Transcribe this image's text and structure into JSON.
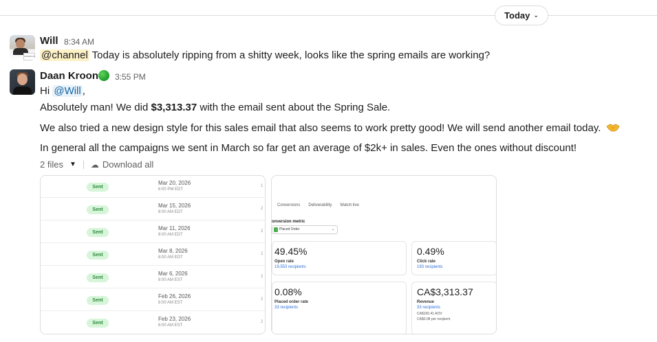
{
  "divider": {
    "label": "Today"
  },
  "messages": [
    {
      "author": "Will",
      "time": "8:34 AM",
      "mention": "@channel",
      "text": " Today is absolutely ripping from a shitty week, looks like the spring emails are working?"
    },
    {
      "author": "Daan Kroon",
      "time": "3:55 PM",
      "greeting": "Hi ",
      "mention": "@Will",
      "greeting_end": ",",
      "line2_pre": "Absolutely man! We did ",
      "line2_bold": "$3,313.37",
      "line2_post": " with the email sent about the Spring Sale.",
      "line3": "We also tried a new design style for this sales email that also seems to work pretty good! We will send another email today.",
      "line4": "In general all the campaigns we sent in March so far get an average of $2k+ in sales. Even the ones without discount!"
    }
  ],
  "attachments": {
    "count_label": "2 files",
    "download_label": "Download all"
  },
  "email_list": {
    "rows": [
      {
        "status": "Sent",
        "date": "Mar 20, 2026",
        "time": "6:00 PM EDT",
        "edge": "1"
      },
      {
        "status": "Sent",
        "date": "Mar 15, 2026",
        "time": "8:00 AM EDT",
        "edge": "2"
      },
      {
        "status": "Sent",
        "date": "Mar 11, 2026",
        "time": "8:00 AM EDT",
        "edge": "2"
      },
      {
        "status": "Sent",
        "date": "Mar 8, 2026",
        "time": "8:00 AM EDT",
        "edge": "2"
      },
      {
        "status": "Sent",
        "date": "Mar 6, 2026",
        "time": "8:00 AM EST",
        "edge": "2"
      },
      {
        "status": "Sent",
        "date": "Feb 26, 2026",
        "time": "8:00 AM EST",
        "edge": "2"
      },
      {
        "status": "Sent",
        "date": "Feb 23, 2026",
        "time": "8:00 AM EST",
        "edge": "2"
      }
    ]
  },
  "metrics": {
    "tabs": [
      "Conversions",
      "Deliverability",
      "Watch live"
    ],
    "conversion_label": "onversion metric",
    "conversion_value": "Placed Order",
    "open_rate": {
      "value": "49.45%",
      "label": "Open rate",
      "sub": "19,553 recipients"
    },
    "click_rate": {
      "value": "0.49%",
      "label": "Click rate",
      "sub": "193 recipients"
    },
    "placed_rate": {
      "value": "0.08%",
      "label": "Placed order rate",
      "sub": "33 recipients"
    },
    "revenue": {
      "value": "CA$3,313.37",
      "label": "Revenue",
      "sub": "33 recipients",
      "aov": "CA$100.41 AOV",
      "per": "CA$0.08 per recipient"
    }
  }
}
